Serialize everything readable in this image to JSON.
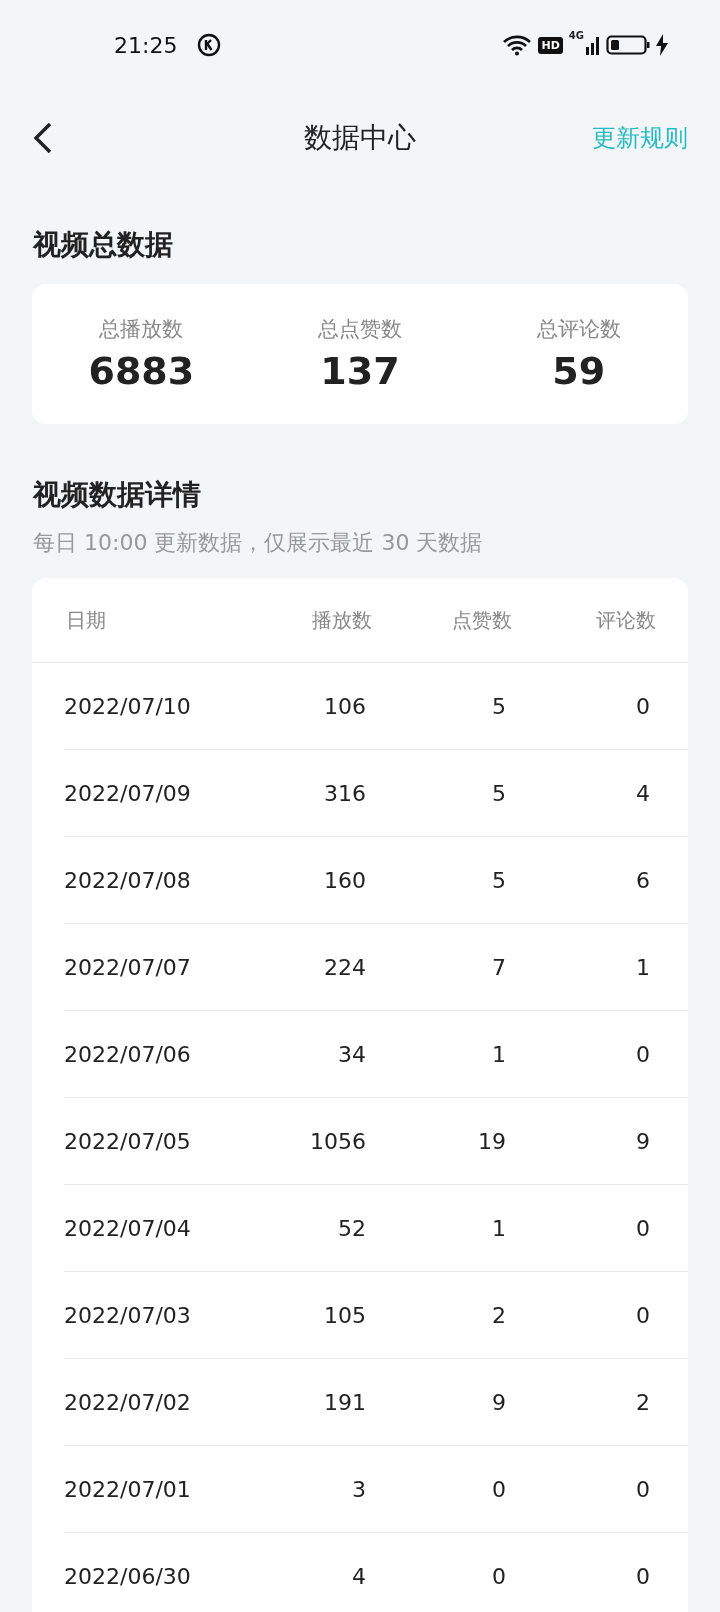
{
  "status_bar": {
    "time": "21:25",
    "hd": "HD",
    "network": "4G"
  },
  "header": {
    "title": "数据中心",
    "action": "更新规则"
  },
  "summary": {
    "title": "视频总数据",
    "stats": [
      {
        "label": "总播放数",
        "value": "6883"
      },
      {
        "label": "总点赞数",
        "value": "137"
      },
      {
        "label": "总评论数",
        "value": "59"
      }
    ]
  },
  "details": {
    "title": "视频数据详情",
    "subtitle": "每日 10:00 更新数据，仅展示最近 30 天数据",
    "table": {
      "columns": [
        "日期",
        "播放数",
        "点赞数",
        "评论数"
      ],
      "rows": [
        [
          "2022/07/10",
          "106",
          "5",
          "0"
        ],
        [
          "2022/07/09",
          "316",
          "5",
          "4"
        ],
        [
          "2022/07/08",
          "160",
          "5",
          "6"
        ],
        [
          "2022/07/07",
          "224",
          "7",
          "1"
        ],
        [
          "2022/07/06",
          "34",
          "1",
          "0"
        ],
        [
          "2022/07/05",
          "1056",
          "19",
          "9"
        ],
        [
          "2022/07/04",
          "52",
          "1",
          "0"
        ],
        [
          "2022/07/03",
          "105",
          "2",
          "0"
        ],
        [
          "2022/07/02",
          "191",
          "9",
          "2"
        ],
        [
          "2022/07/01",
          "3",
          "0",
          "0"
        ],
        [
          "2022/06/30",
          "4",
          "0",
          "0"
        ]
      ]
    }
  }
}
